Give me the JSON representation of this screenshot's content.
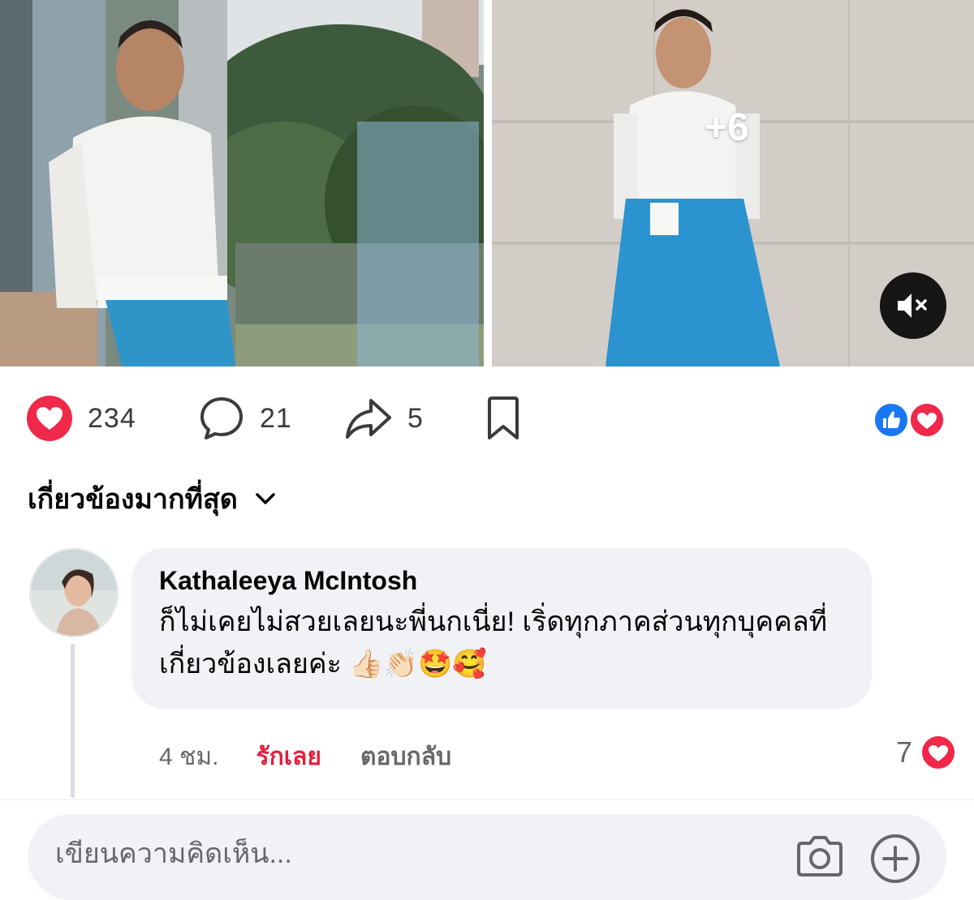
{
  "media": {
    "more_photos_label": "+6",
    "mute_icon": "speaker-muted-icon"
  },
  "actions": {
    "likes_count": "234",
    "comments_count": "21",
    "shares_count": "5",
    "icons": [
      "heart-icon",
      "comment-icon",
      "share-icon",
      "bookmark-icon"
    ],
    "reaction_icons": [
      "like-reaction-icon",
      "love-reaction-icon"
    ]
  },
  "sort": {
    "label": "เกี่ยวข้องมากที่สุด"
  },
  "comment": {
    "author": "Kathaleeya McIntosh",
    "text": "ก็ไม่เคยไม่สวยเลยนะพี่นกเนี่ย! เริ่ดทุกภาคส่วนทุกบุคคลที่เกี่ยวข้องเลยค่ะ",
    "emojis": "👍🏻👏🏻🤩🥰",
    "time": "4 ชม.",
    "love_label": "รักเลย",
    "reply_label": "ตอบกลับ",
    "reaction_count": "7"
  },
  "composer": {
    "placeholder": "เขียนความคิดเห็น..."
  },
  "colors": {
    "love_red": "#e41e3f",
    "like_blue": "#1877f2",
    "bubble_bg": "#f0f2f5",
    "muted_text": "#65676b"
  }
}
